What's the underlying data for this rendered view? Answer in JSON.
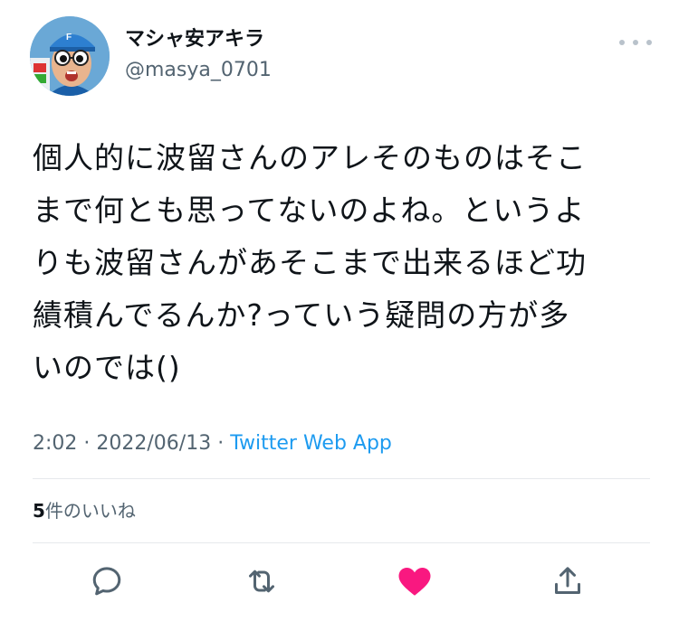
{
  "profile": {
    "display_name": "マシャ安アキラ",
    "handle": "@masya_0701",
    "avatar_icon": "user-avatar"
  },
  "tweet": {
    "lines": [
      "個人的に波留さんのアレそのものはそこ",
      "まで何とも思ってないのよね。というよ",
      "りも波留さんがあそこまで出来るほど功",
      "績積んでるんか?っていう疑問の方が多",
      "いのでは()"
    ]
  },
  "meta": {
    "time": "2:02",
    "separator": "·",
    "date": "2022/06/13",
    "app": "Twitter Web App"
  },
  "likes": {
    "count": "5",
    "label": "件のいいね"
  },
  "actions": [
    {
      "name": "reply",
      "icon": "reply-icon"
    },
    {
      "name": "retweet",
      "icon": "retweet-icon"
    },
    {
      "name": "like",
      "icon": "heart-icon",
      "active": true
    },
    {
      "name": "share",
      "icon": "share-icon"
    }
  ],
  "colors": {
    "like_active": "#f91880",
    "link": "#1d9bf0",
    "secondary_text": "#536471",
    "divider": "#e6e9ec"
  }
}
